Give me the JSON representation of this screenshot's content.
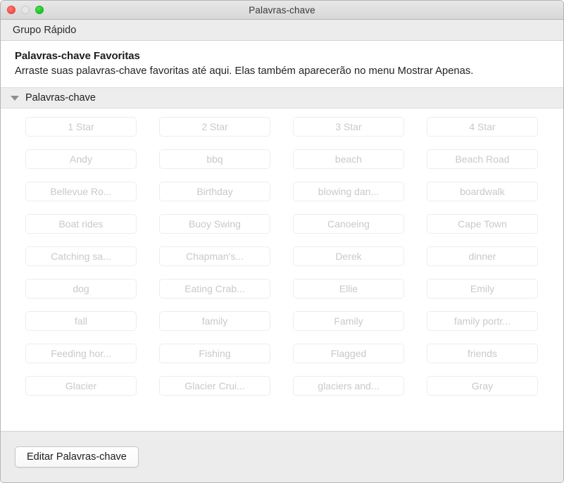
{
  "window": {
    "title": "Palavras-chave",
    "traffic_lights": [
      {
        "name": "close",
        "color": "#f9534b"
      },
      {
        "name": "minimize",
        "color": "#e7e6e7"
      },
      {
        "name": "zoom",
        "color": "#1fc629"
      }
    ]
  },
  "toolbar": {
    "label": "Grupo Rápido"
  },
  "info": {
    "heading": "Palavras-chave Favoritas",
    "body": "Arraste suas palavras-chave favoritas até aqui. Elas também aparecerão no menu Mostrar Apenas."
  },
  "section": {
    "title": "Palavras-chave",
    "expanded": true
  },
  "keywords": [
    "1 Star",
    "2 Star",
    "3 Star",
    "4 Star",
    "Andy",
    "bbq",
    "beach",
    "Beach Road",
    "Bellevue Ro...",
    "Birthday",
    "blowing dan...",
    "boardwalk",
    "Boat rides",
    "Buoy Swing",
    "Canoeing",
    "Cape Town",
    "Catching sa...",
    "Chapman's...",
    "Derek",
    "dinner",
    "dog",
    "Eating Crab...",
    "Ellie",
    "Emily",
    "fall",
    "family",
    "Family",
    "family portr...",
    "Feeding hor...",
    "Fishing",
    "Flagged",
    "friends",
    "Glacier",
    "Glacier Crui...",
    "glaciers and...",
    "Gray"
  ],
  "footer": {
    "edit_button_label": "Editar Palavras-chave"
  }
}
